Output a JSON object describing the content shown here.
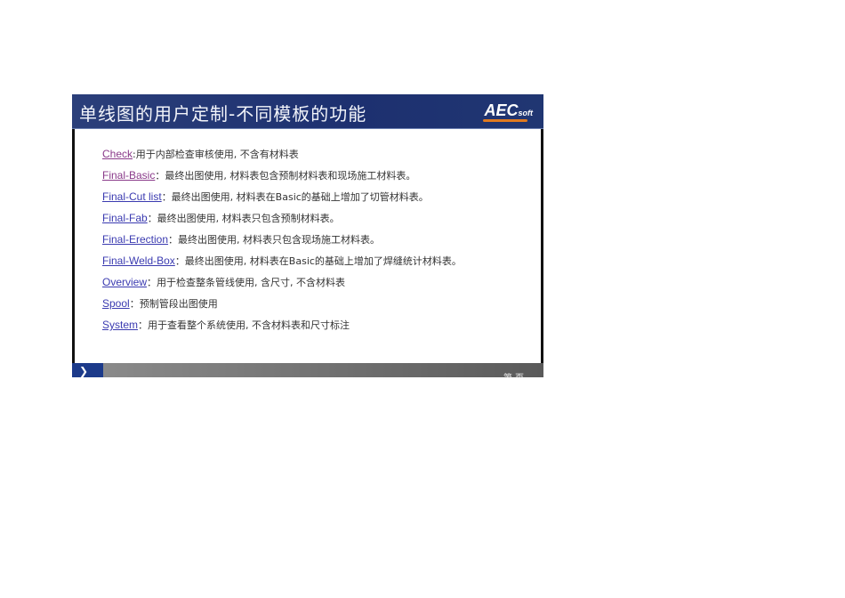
{
  "slide": {
    "title": "单线图的用户定制-不同模板的功能",
    "logo": {
      "main": "AEC",
      "sub": "soft"
    },
    "items": [
      {
        "name": "Check",
        "desc": ":用于内部检查审核使用, 不含有材料表"
      },
      {
        "name": "Final-Basic",
        "desc": "：最终出图使用, 材料表包含预制材料表和现场施工材料表。"
      },
      {
        "name": "Final-Cut list",
        "desc": "：最终出图使用, 材料表在Basic的基础上增加了切管材料表。"
      },
      {
        "name": "Final-Fab",
        "desc": "：最终出图使用, 材料表只包含预制材料表。"
      },
      {
        "name": "Final-Erection",
        "desc": "：最终出图使用, 材料表只包含现场施工材料表。"
      },
      {
        "name": "Final-Weld-Box",
        "desc": "：最终出图使用, 材料表在Basic的基础上增加了焊缝统计材料表。"
      },
      {
        "name": "Overview",
        "desc": "：用于检查整条管线使用, 含尺寸, 不含材料表"
      },
      {
        "name": "Spool",
        "desc": "：预制管段出图使用"
      },
      {
        "name": "System",
        "desc": "：用于查看整个系统使用, 不含材料表和尺寸标注"
      }
    ],
    "footer": {
      "next_icon": "chevron-right",
      "page": "第  页"
    }
  }
}
